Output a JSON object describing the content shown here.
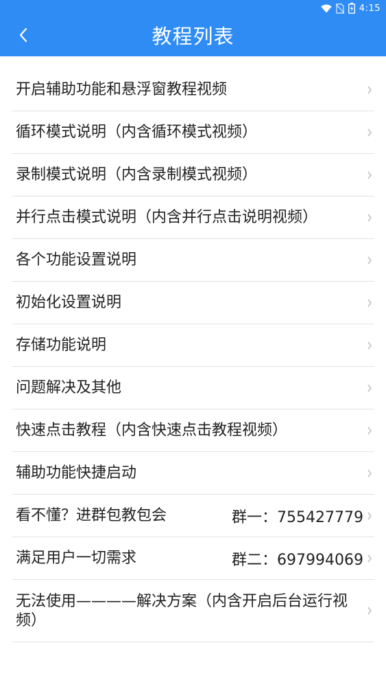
{
  "status": {
    "time": "4:15",
    "icons": [
      "wifi-icon",
      "no-sim-icon",
      "battery-icon"
    ]
  },
  "header": {
    "title": "教程列表",
    "back_icon": "chevron-left-icon",
    "background": "#2f8cf4"
  },
  "list": {
    "items": [
      {
        "label": "开启辅助功能和悬浮窗教程视频"
      },
      {
        "label": "循环模式说明（内含循环模式视频）"
      },
      {
        "label": "录制模式说明（内含录制模式视频）"
      },
      {
        "label": "并行点击模式说明（内含并行点击说明视频）"
      },
      {
        "label": "各个功能设置说明"
      },
      {
        "label": "初始化设置说明"
      },
      {
        "label": "存储功能说明"
      },
      {
        "label": "问题解决及其他"
      },
      {
        "label": "快速点击教程（内含快速点击教程视频）"
      },
      {
        "label": "辅助功能快捷启动"
      },
      {
        "label": "看不懂？进群包教包会",
        "right": "群一：755427779"
      },
      {
        "label": "满足用户一切需求",
        "right": "群二：697994069"
      },
      {
        "label": "无法使用————解决方案（内含开启后台运行视频）"
      }
    ]
  }
}
